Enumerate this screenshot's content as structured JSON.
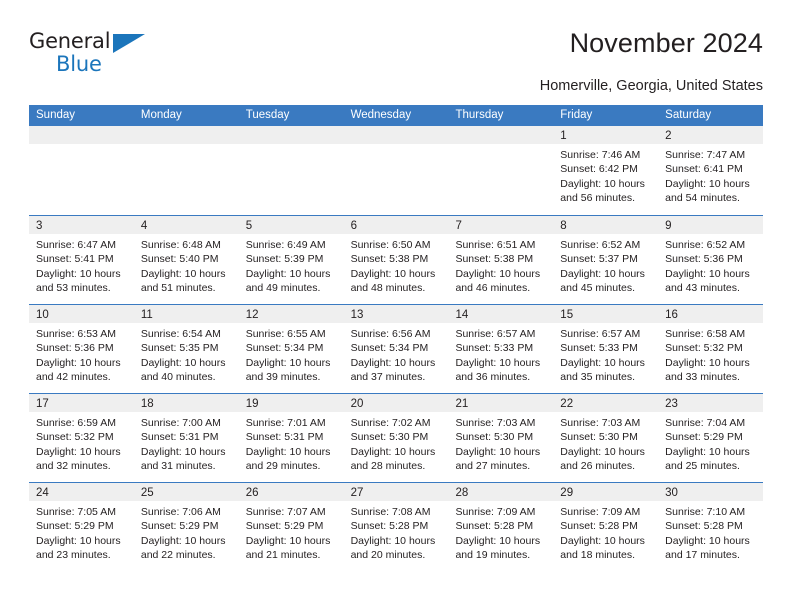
{
  "brand": {
    "name_primary": "General",
    "name_secondary": "Blue",
    "accent_color": "#1b75bb"
  },
  "header": {
    "title": "November 2024",
    "subtitle": "Homerville, Georgia, United States"
  },
  "theme": {
    "header_blue": "#3a7ac1",
    "band_gray": "#efefef",
    "text": "#231f20"
  },
  "calendar": {
    "weekdays": [
      "Sunday",
      "Monday",
      "Tuesday",
      "Wednesday",
      "Thursday",
      "Friday",
      "Saturday"
    ],
    "weeks": [
      [
        {
          "day": ""
        },
        {
          "day": ""
        },
        {
          "day": ""
        },
        {
          "day": ""
        },
        {
          "day": ""
        },
        {
          "day": "1",
          "sunrise": "Sunrise: 7:46 AM",
          "sunset": "Sunset: 6:42 PM",
          "daylight": "Daylight: 10 hours and 56 minutes."
        },
        {
          "day": "2",
          "sunrise": "Sunrise: 7:47 AM",
          "sunset": "Sunset: 6:41 PM",
          "daylight": "Daylight: 10 hours and 54 minutes."
        }
      ],
      [
        {
          "day": "3",
          "sunrise": "Sunrise: 6:47 AM",
          "sunset": "Sunset: 5:41 PM",
          "daylight": "Daylight: 10 hours and 53 minutes."
        },
        {
          "day": "4",
          "sunrise": "Sunrise: 6:48 AM",
          "sunset": "Sunset: 5:40 PM",
          "daylight": "Daylight: 10 hours and 51 minutes."
        },
        {
          "day": "5",
          "sunrise": "Sunrise: 6:49 AM",
          "sunset": "Sunset: 5:39 PM",
          "daylight": "Daylight: 10 hours and 49 minutes."
        },
        {
          "day": "6",
          "sunrise": "Sunrise: 6:50 AM",
          "sunset": "Sunset: 5:38 PM",
          "daylight": "Daylight: 10 hours and 48 minutes."
        },
        {
          "day": "7",
          "sunrise": "Sunrise: 6:51 AM",
          "sunset": "Sunset: 5:38 PM",
          "daylight": "Daylight: 10 hours and 46 minutes."
        },
        {
          "day": "8",
          "sunrise": "Sunrise: 6:52 AM",
          "sunset": "Sunset: 5:37 PM",
          "daylight": "Daylight: 10 hours and 45 minutes."
        },
        {
          "day": "9",
          "sunrise": "Sunrise: 6:52 AM",
          "sunset": "Sunset: 5:36 PM",
          "daylight": "Daylight: 10 hours and 43 minutes."
        }
      ],
      [
        {
          "day": "10",
          "sunrise": "Sunrise: 6:53 AM",
          "sunset": "Sunset: 5:36 PM",
          "daylight": "Daylight: 10 hours and 42 minutes."
        },
        {
          "day": "11",
          "sunrise": "Sunrise: 6:54 AM",
          "sunset": "Sunset: 5:35 PM",
          "daylight": "Daylight: 10 hours and 40 minutes."
        },
        {
          "day": "12",
          "sunrise": "Sunrise: 6:55 AM",
          "sunset": "Sunset: 5:34 PM",
          "daylight": "Daylight: 10 hours and 39 minutes."
        },
        {
          "day": "13",
          "sunrise": "Sunrise: 6:56 AM",
          "sunset": "Sunset: 5:34 PM",
          "daylight": "Daylight: 10 hours and 37 minutes."
        },
        {
          "day": "14",
          "sunrise": "Sunrise: 6:57 AM",
          "sunset": "Sunset: 5:33 PM",
          "daylight": "Daylight: 10 hours and 36 minutes."
        },
        {
          "day": "15",
          "sunrise": "Sunrise: 6:57 AM",
          "sunset": "Sunset: 5:33 PM",
          "daylight": "Daylight: 10 hours and 35 minutes."
        },
        {
          "day": "16",
          "sunrise": "Sunrise: 6:58 AM",
          "sunset": "Sunset: 5:32 PM",
          "daylight": "Daylight: 10 hours and 33 minutes."
        }
      ],
      [
        {
          "day": "17",
          "sunrise": "Sunrise: 6:59 AM",
          "sunset": "Sunset: 5:32 PM",
          "daylight": "Daylight: 10 hours and 32 minutes."
        },
        {
          "day": "18",
          "sunrise": "Sunrise: 7:00 AM",
          "sunset": "Sunset: 5:31 PM",
          "daylight": "Daylight: 10 hours and 31 minutes."
        },
        {
          "day": "19",
          "sunrise": "Sunrise: 7:01 AM",
          "sunset": "Sunset: 5:31 PM",
          "daylight": "Daylight: 10 hours and 29 minutes."
        },
        {
          "day": "20",
          "sunrise": "Sunrise: 7:02 AM",
          "sunset": "Sunset: 5:30 PM",
          "daylight": "Daylight: 10 hours and 28 minutes."
        },
        {
          "day": "21",
          "sunrise": "Sunrise: 7:03 AM",
          "sunset": "Sunset: 5:30 PM",
          "daylight": "Daylight: 10 hours and 27 minutes."
        },
        {
          "day": "22",
          "sunrise": "Sunrise: 7:03 AM",
          "sunset": "Sunset: 5:30 PM",
          "daylight": "Daylight: 10 hours and 26 minutes."
        },
        {
          "day": "23",
          "sunrise": "Sunrise: 7:04 AM",
          "sunset": "Sunset: 5:29 PM",
          "daylight": "Daylight: 10 hours and 25 minutes."
        }
      ],
      [
        {
          "day": "24",
          "sunrise": "Sunrise: 7:05 AM",
          "sunset": "Sunset: 5:29 PM",
          "daylight": "Daylight: 10 hours and 23 minutes."
        },
        {
          "day": "25",
          "sunrise": "Sunrise: 7:06 AM",
          "sunset": "Sunset: 5:29 PM",
          "daylight": "Daylight: 10 hours and 22 minutes."
        },
        {
          "day": "26",
          "sunrise": "Sunrise: 7:07 AM",
          "sunset": "Sunset: 5:29 PM",
          "daylight": "Daylight: 10 hours and 21 minutes."
        },
        {
          "day": "27",
          "sunrise": "Sunrise: 7:08 AM",
          "sunset": "Sunset: 5:28 PM",
          "daylight": "Daylight: 10 hours and 20 minutes."
        },
        {
          "day": "28",
          "sunrise": "Sunrise: 7:09 AM",
          "sunset": "Sunset: 5:28 PM",
          "daylight": "Daylight: 10 hours and 19 minutes."
        },
        {
          "day": "29",
          "sunrise": "Sunrise: 7:09 AM",
          "sunset": "Sunset: 5:28 PM",
          "daylight": "Daylight: 10 hours and 18 minutes."
        },
        {
          "day": "30",
          "sunrise": "Sunrise: 7:10 AM",
          "sunset": "Sunset: 5:28 PM",
          "daylight": "Daylight: 10 hours and 17 minutes."
        }
      ]
    ]
  }
}
